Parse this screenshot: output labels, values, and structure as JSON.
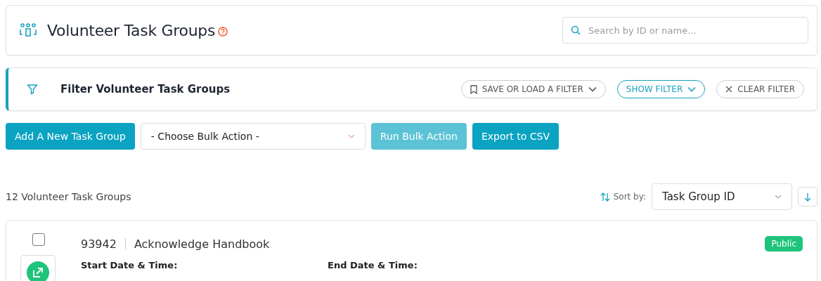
{
  "header": {
    "title": "Volunteer Task Groups",
    "search": {
      "placeholder": "Search by ID or name..."
    }
  },
  "filter": {
    "title": "Filter Volunteer Task Groups",
    "buttons": [
      {
        "label": "SAVE OR LOAD A FILTER",
        "kind": "bookmark",
        "active": false
      },
      {
        "label": "SHOW FILTER",
        "kind": "toggle",
        "active": true
      },
      {
        "label": "CLEAR FILTER",
        "kind": "clear",
        "active": false
      }
    ]
  },
  "actions": {
    "add_button": "Add A New Task Group",
    "bulk_select": {
      "value": "- Choose Bulk Action -"
    },
    "buttons": [
      {
        "label": "Run Bulk Action",
        "disabled": true
      },
      {
        "label": "Export to CSV",
        "disabled": false
      }
    ]
  },
  "list": {
    "count": "12 Volunteer Task Groups",
    "sort_label": "Sort by:",
    "sort_value": "Task Group ID"
  },
  "items": [
    {
      "id": "93942",
      "name": "Acknowledge Handbook",
      "badge": "Public",
      "checked": false,
      "start_label": "Start Date & Time:",
      "end_label": "End Date & Time:"
    }
  ]
}
